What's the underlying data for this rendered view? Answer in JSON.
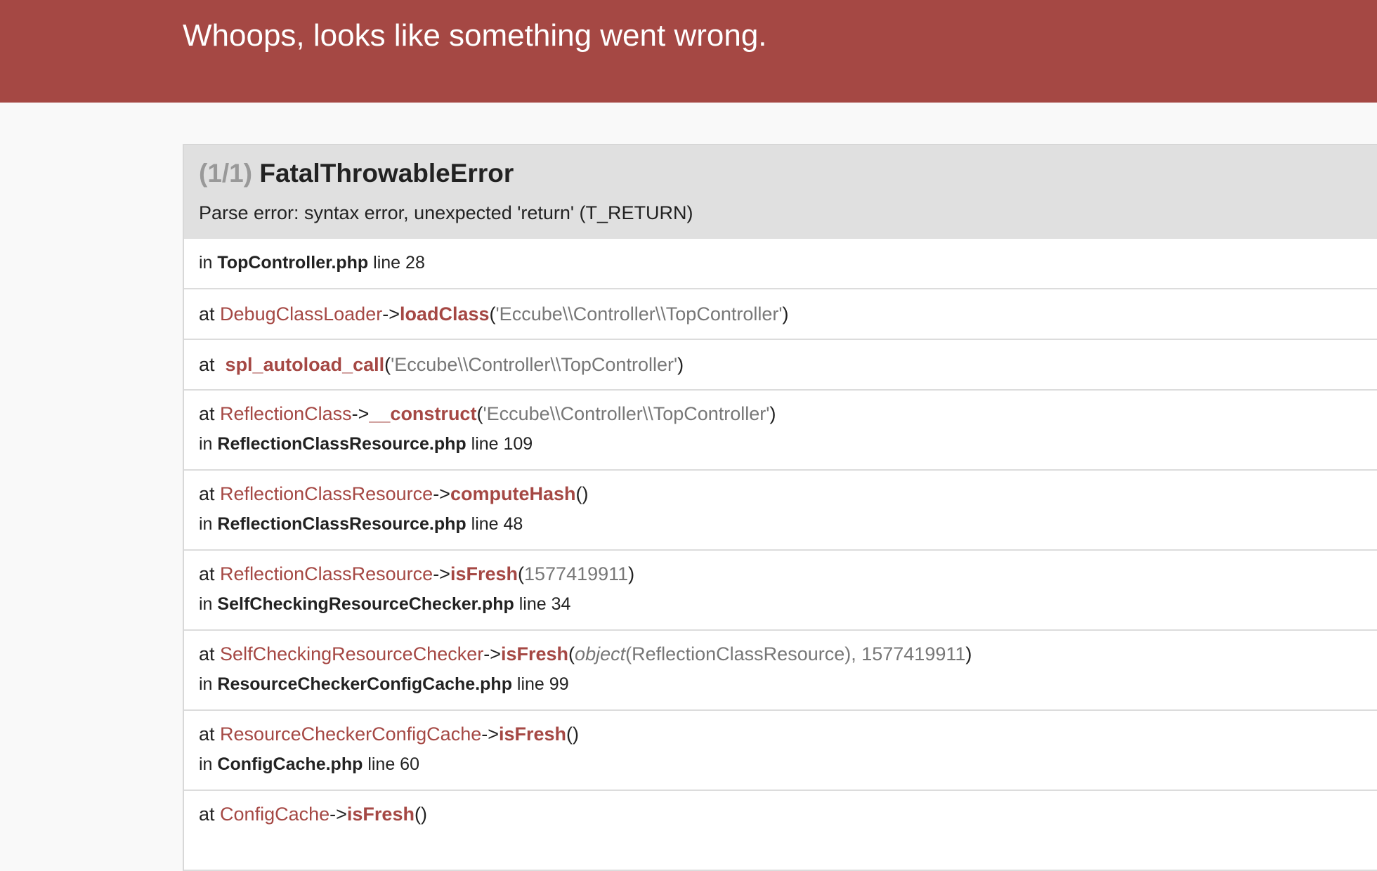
{
  "header": {
    "title": "Whoops, looks like something went wrong."
  },
  "exception": {
    "count": "(1/1)",
    "class": "FatalThrowableError",
    "message": "Parse error: syntax error, unexpected 'return' (T_RETURN)"
  },
  "location": {
    "prefix": "in",
    "file": "TopController.php",
    "line_label": "line 28"
  },
  "trace": [
    {
      "at": "at",
      "cls": "DebugClassLoader",
      "arrow": "->",
      "fn": "loadClass",
      "open": "(",
      "args": "'Eccube\\\\Controller\\\\TopController'",
      "close": ")"
    },
    {
      "at": "at",
      "cls": "",
      "arrow": "",
      "fn": "spl_autoload_call",
      "open": "(",
      "args": "'Eccube\\\\Controller\\\\TopController'",
      "close": ")"
    },
    {
      "at": "at",
      "cls": "ReflectionClass",
      "arrow": "->",
      "fn": "__construct",
      "open": "(",
      "args": "'Eccube\\\\Controller\\\\TopController'",
      "close": ")",
      "in": "in",
      "file": "ReflectionClassResource.php",
      "line": "line 109"
    },
    {
      "at": "at",
      "cls": "ReflectionClassResource",
      "arrow": "->",
      "fn": "computeHash",
      "open": "(",
      "args": "",
      "close": ")",
      "in": "in",
      "file": "ReflectionClassResource.php",
      "line": "line 48"
    },
    {
      "at": "at",
      "cls": "ReflectionClassResource",
      "arrow": "->",
      "fn": "isFresh",
      "open": "(",
      "args": "1577419911",
      "close": ")",
      "in": "in",
      "file": "SelfCheckingResourceChecker.php",
      "line": "line 34"
    },
    {
      "at": "at",
      "cls": "SelfCheckingResourceChecker",
      "arrow": "->",
      "fn": "isFresh",
      "open": "(",
      "obj": "object",
      "args": "(ReflectionClassResource), 1577419911",
      "close": ")",
      "in": "in",
      "file": "ResourceCheckerConfigCache.php",
      "line": "line 99"
    },
    {
      "at": "at",
      "cls": "ResourceCheckerConfigCache",
      "arrow": "->",
      "fn": "isFresh",
      "open": "(",
      "args": "",
      "close": ")",
      "in": "in",
      "file": "ConfigCache.php",
      "line": "line 60"
    },
    {
      "at": "at",
      "cls": "ConfigCache",
      "arrow": "->",
      "fn": "isFresh",
      "open": "(",
      "args": "",
      "close": ")"
    }
  ]
}
